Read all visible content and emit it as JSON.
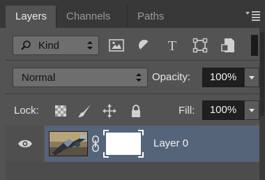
{
  "tabs": [
    {
      "label": "Layers"
    },
    {
      "label": "Channels"
    },
    {
      "label": "Paths"
    }
  ],
  "filter": {
    "kind_label": "Kind",
    "buttons": [
      "image-filter-icon",
      "adjustment-filter-icon",
      "type-filter-icon",
      "shape-filter-icon",
      "smart-object-filter-icon"
    ]
  },
  "blend": {
    "mode": "Normal",
    "opacity_label": "Opacity:",
    "opacity_value": "100%"
  },
  "lock": {
    "label": "Lock:",
    "icons": [
      "lock-transparent-pixels-icon",
      "lock-image-pixels-icon",
      "lock-position-icon",
      "lock-all-icon"
    ],
    "fill_label": "Fill:",
    "fill_value": "100%"
  },
  "layers": [
    {
      "name": "Layer 0",
      "visible": true,
      "selected": true,
      "has_mask": true,
      "linked": true
    }
  ],
  "text_icons": {
    "type_glyph": "T"
  },
  "colors": {
    "panel_bg": "#535353",
    "tab_bar_bg": "#383838",
    "selected_layer_bg": "#56647a",
    "field_bg": "#1f1f1f"
  }
}
